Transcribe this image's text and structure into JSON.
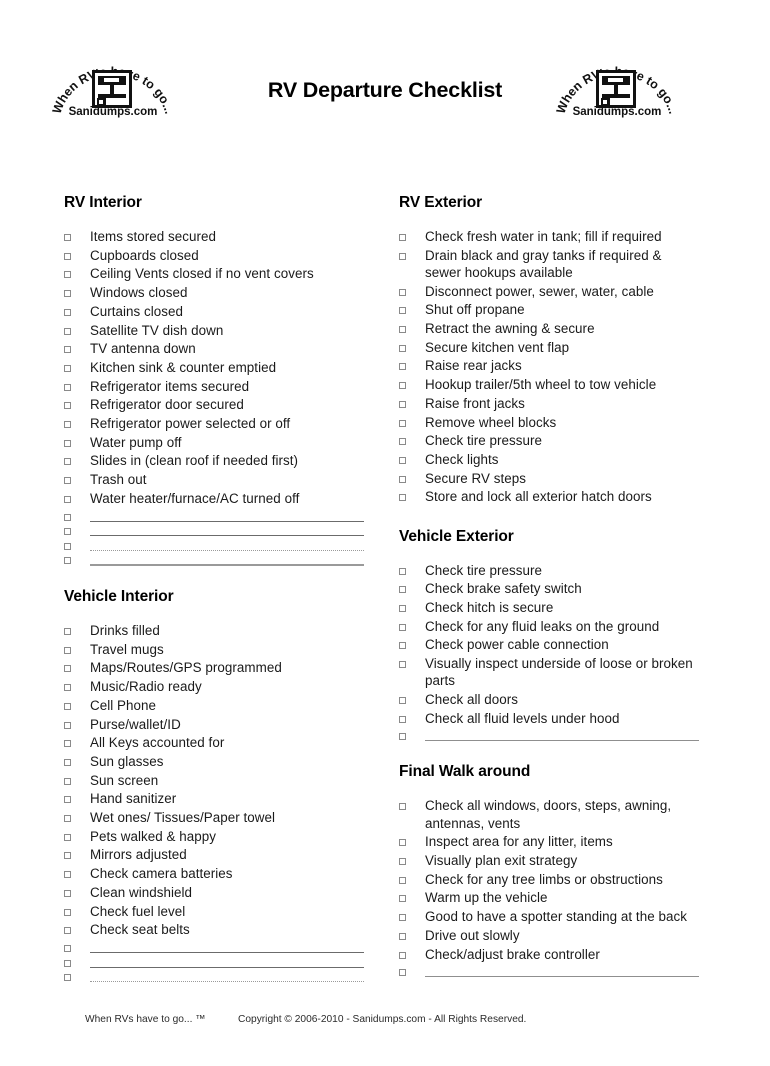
{
  "document": {
    "title": "RV Departure Checklist"
  },
  "logo": {
    "arc_text": "When RV's have to go...",
    "wordmark": "Sanidumps.com",
    "icon": "rv-dump-station-icon"
  },
  "footer": {
    "tagline": "When RVs have to go... ™",
    "copyright": "Copyright © 2006-2010 - Sanidumps.com - All Rights Reserved."
  },
  "sections": {
    "rv_interior": {
      "heading": "RV Interior",
      "items": [
        "Items stored secured",
        "Cupboards closed",
        "Ceiling Vents closed if no vent covers",
        "Windows closed",
        "Curtains closed",
        "Satellite TV dish down",
        "TV antenna down",
        "Kitchen sink  & counter emptied",
        "Refrigerator items secured",
        "Refrigerator door secured",
        "Refrigerator power selected or off",
        "Water pump off",
        "Slides in (clean roof if needed first)",
        "Trash out",
        "Water heater/furnace/AC turned off"
      ],
      "blank_lines": 4
    },
    "vehicle_interior": {
      "heading": "Vehicle Interior",
      "items": [
        "Drinks filled",
        "Travel mugs",
        "Maps/Routes/GPS programmed",
        "Music/Radio ready",
        "Cell Phone",
        "Purse/wallet/ID",
        "All Keys accounted for",
        "Sun glasses",
        "Sun screen",
        "Hand sanitizer",
        "Wet ones/ Tissues/Paper towel",
        "Pets walked & happy",
        "Mirrors adjusted",
        "Check camera batteries",
        "Clean windshield",
        "Check fuel level",
        "Check seat belts"
      ],
      "blank_lines": 3
    },
    "rv_exterior": {
      "heading": "RV Exterior",
      "items": [
        "Check fresh water in tank; fill if required",
        "Drain black and gray tanks if required & sewer hookups available",
        "Disconnect power, sewer, water, cable",
        "Shut off propane",
        "Retract the awning & secure",
        "Secure kitchen vent flap",
        "Raise rear jacks",
        "Hookup trailer/5th wheel to tow vehicle",
        "Raise front jacks",
        "Remove wheel blocks",
        "Check tire pressure",
        "Check lights",
        "Secure RV steps",
        "Store and lock all exterior hatch doors"
      ],
      "blank_lines": 0
    },
    "vehicle_exterior": {
      "heading": "Vehicle Exterior",
      "items": [
        "Check tire pressure",
        "Check brake safety switch",
        "Check hitch is secure",
        "Check for any fluid leaks on the ground",
        "Check power cable connection",
        "Visually inspect underside of loose or broken parts",
        "Check all doors",
        "Check all fluid levels under hood"
      ],
      "blank_lines": 1
    },
    "final_walk_around": {
      "heading": "Final Walk around",
      "items": [
        "Check all windows, doors, steps, awning, antennas, vents",
        "Inspect area for any litter, items",
        "Visually plan exit strategy",
        "Check for any tree limbs or obstructions",
        "Warm up the vehicle",
        "Good to have a spotter standing at the back",
        "Drive out slowly",
        "Check/adjust brake controller"
      ],
      "blank_lines": 1
    }
  }
}
